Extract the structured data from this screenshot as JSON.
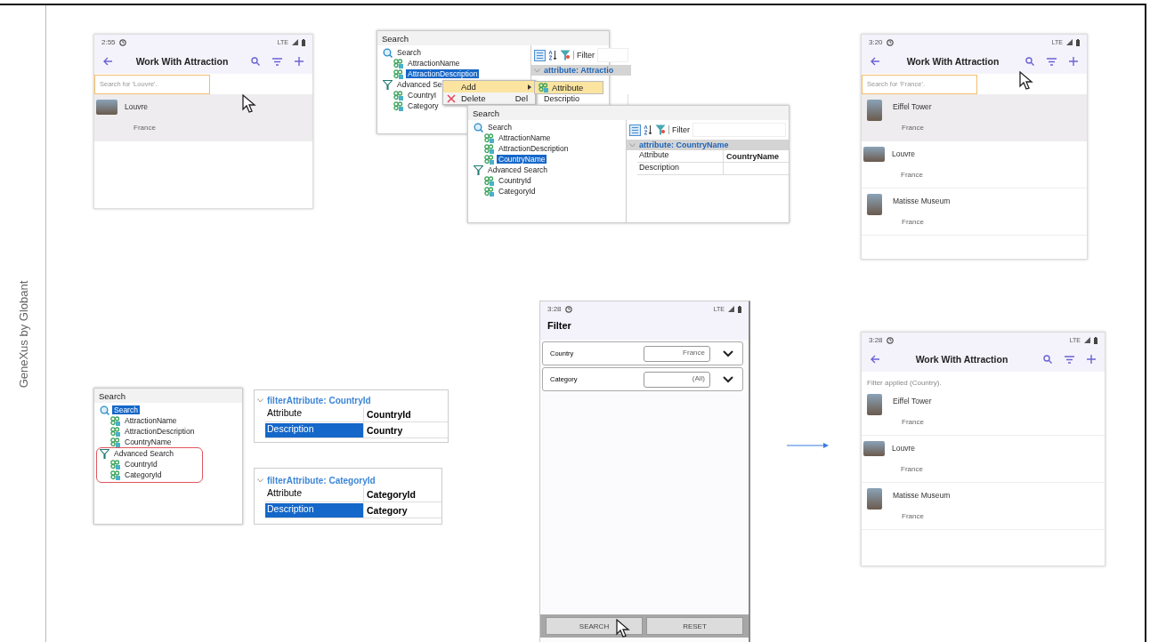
{
  "slide": {
    "caption": "GeneXus by Globant"
  },
  "phones": [
    {
      "time": "2:55",
      "network": "LTE",
      "title": "Work With Attraction",
      "search_placeholder": "Search for 'Louvre'.",
      "rows": [
        {
          "name": "Louvre",
          "country": "France",
          "selected": true
        }
      ]
    },
    {
      "time": "3:20",
      "network": "LTE",
      "title": "Work With Attraction",
      "search_placeholder": "Search for 'France'.",
      "rows": [
        {
          "name": "Eiffel Tower",
          "country": "France",
          "selected": true
        },
        {
          "name": "Louvre",
          "country": "France",
          "selected": false
        },
        {
          "name": "Matisse Museum",
          "country": "France",
          "selected": false
        }
      ]
    },
    {
      "time": "3:28",
      "network": "LTE",
      "title": "Work With Attraction",
      "message": "Filter applied (Country).",
      "rows": [
        {
          "name": "Eiffel Tower",
          "country": "France",
          "selected": false
        },
        {
          "name": "Louvre",
          "country": "France",
          "selected": false
        },
        {
          "name": "Matisse Museum",
          "country": "France",
          "selected": false
        }
      ]
    }
  ],
  "ide_panels": [
    {
      "title": "Search",
      "tree": [
        {
          "label": "Search",
          "kind": "search",
          "selected": false,
          "children": [
            {
              "label": "AttractionName",
              "kind": "attribute",
              "selected": false
            },
            {
              "label": "AttractionDescription",
              "kind": "attribute",
              "selected": true
            }
          ]
        },
        {
          "label": "Advanced Se",
          "kind": "filter",
          "selected": false,
          "children": [
            {
              "label": "CountryI",
              "kind": "attribute",
              "selected": false
            },
            {
              "label": "Category",
              "kind": "attribute",
              "selected": false
            }
          ]
        }
      ],
      "toolbar_label": "Filter",
      "property_header": "attribute: Attractio",
      "properties": [
        {
          "name": "Descriptio",
          "selected": false
        }
      ],
      "context_menu": [
        {
          "label": "Add",
          "kind": "submenu",
          "selected": true
        },
        {
          "label": "Delete",
          "shortcut": "Del",
          "kind": "delete",
          "selected": false
        }
      ],
      "submenu": [
        {
          "label": "Attribute",
          "selected": true
        }
      ]
    },
    {
      "title": "Search",
      "tree": [
        {
          "label": "Search",
          "kind": "search",
          "selected": false,
          "children": [
            {
              "label": "AttractionName",
              "kind": "attribute",
              "selected": false
            },
            {
              "label": "AttractionDescription",
              "kind": "attribute",
              "selected": false
            },
            {
              "label": "CountryName",
              "kind": "attribute",
              "selected": true
            }
          ]
        },
        {
          "label": "Advanced Search",
          "kind": "filter",
          "selected": false,
          "children": [
            {
              "label": "CountryId",
              "kind": "attribute",
              "selected": false
            },
            {
              "label": "CategoryId",
              "kind": "attribute",
              "selected": false
            }
          ]
        }
      ],
      "toolbar_label": "Filter",
      "property_header": "attribute: CountryName",
      "properties": [
        {
          "name": "Attribute",
          "value": "CountryName",
          "selected": false
        },
        {
          "name": "Description",
          "selected": false
        }
      ]
    },
    {
      "title": "Search",
      "tree": [
        {
          "label": "Search",
          "kind": "search",
          "selected": true,
          "children": [
            {
              "label": "AttractionName",
              "kind": "attribute",
              "selected": false
            },
            {
              "label": "AttractionDescription",
              "kind": "attribute",
              "selected": false
            },
            {
              "label": "CountryName",
              "kind": "attribute",
              "selected": false
            }
          ]
        },
        {
          "label": "Advanced Search",
          "kind": "filter",
          "selected": false,
          "highlighted": true,
          "children": [
            {
              "label": "CountryId",
              "kind": "attribute",
              "selected": false
            },
            {
              "label": "CategoryId",
              "kind": "attribute",
              "selected": false
            }
          ]
        }
      ]
    }
  ],
  "property_panels": [
    {
      "header": "filterAttribute: CountryId",
      "properties": [
        {
          "name": "Attribute",
          "value": "CountryId",
          "selected": false
        },
        {
          "name": "Description",
          "value": "Country",
          "selected": true
        }
      ]
    },
    {
      "header": "filterAttribute: CategoryId",
      "properties": [
        {
          "name": "Attribute",
          "value": "CategoryId",
          "selected": false
        },
        {
          "name": "Description",
          "value": "Category",
          "selected": true
        }
      ]
    }
  ],
  "filter_screen": {
    "time": "3:28",
    "network": "LTE",
    "title": "Filter",
    "fields": [
      {
        "label": "Country",
        "value": "France"
      },
      {
        "label": "Category",
        "value": "(All)"
      }
    ],
    "buttons": [
      "SEARCH",
      "RESET"
    ]
  }
}
